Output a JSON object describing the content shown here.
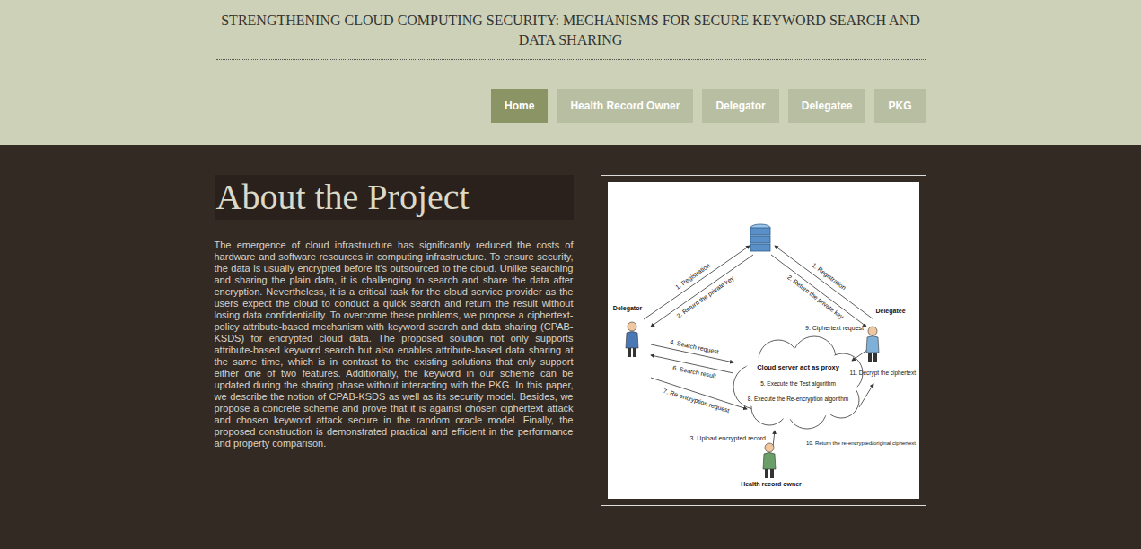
{
  "header": {
    "title": "STRENGTHENING CLOUD COMPUTING SECURITY: MECHANISMS FOR SECURE KEYWORD SEARCH AND DATA SHARING"
  },
  "nav": [
    {
      "label": "Home",
      "selected": true
    },
    {
      "label": "Health Record Owner",
      "selected": false
    },
    {
      "label": "Delegator",
      "selected": false
    },
    {
      "label": "Delegatee",
      "selected": false
    },
    {
      "label": "PKG",
      "selected": false
    }
  ],
  "about": {
    "heading": "About the Project",
    "paragraph": "The emergence of cloud infrastructure has significantly reduced the costs of hardware and software resources in computing infrastructure. To ensure security, the data is usually encrypted before it's outsourced to the cloud. Unlike searching and sharing the plain data, it is challenging to search and share the data after encryption. Nevertheless, it is a critical task for the cloud service provider as the users expect the cloud to conduct a quick search and return the result without losing data confidentiality. To overcome these problems, we propose a ciphertext-policy attribute-based mechanism with keyword search and data sharing (CPAB-KSDS) for encrypted cloud data. The proposed solution not only supports attribute-based keyword search but also enables attribute-based data sharing at the same time, which is in contrast to the existing solutions that only support either one of two features. Additionally, the keyword in our scheme can be updated during the sharing phase without interacting with the PKG. In this paper, we describe the notion of CPAB-KSDS as well as its security model. Besides, we propose a concrete scheme and prove that it is against chosen ciphertext attack and chosen keyword attack secure in the random oracle model. Finally, the proposed construction is demonstrated practical and efficient in the performance and property comparison."
  },
  "figure": {
    "nodes": [
      {
        "label": "Delegator"
      },
      {
        "label": "Delegatee"
      },
      {
        "label": "Health record owner"
      }
    ],
    "cloud": {
      "title": "Cloud server act as proxy",
      "steps": [
        "5. Execute the Test algorithm",
        "8. Execute the Re-encryption algorithm"
      ]
    },
    "arrows": [
      {
        "label": "1. Registration"
      },
      {
        "label": "2. Return the private key"
      },
      {
        "label": "1. Registration"
      },
      {
        "label": "2. Return the private key"
      },
      {
        "label": "4. Search request"
      },
      {
        "label": "6. Search result"
      },
      {
        "label": "7. Re-encryption request"
      },
      {
        "label": "3. Upload encrypted record"
      },
      {
        "label": "9. Ciphertext request"
      },
      {
        "label": "10. Return the re-encrypted/original ciphertext"
      },
      {
        "label": "11. Decrypt the ciphertext"
      }
    ]
  }
}
